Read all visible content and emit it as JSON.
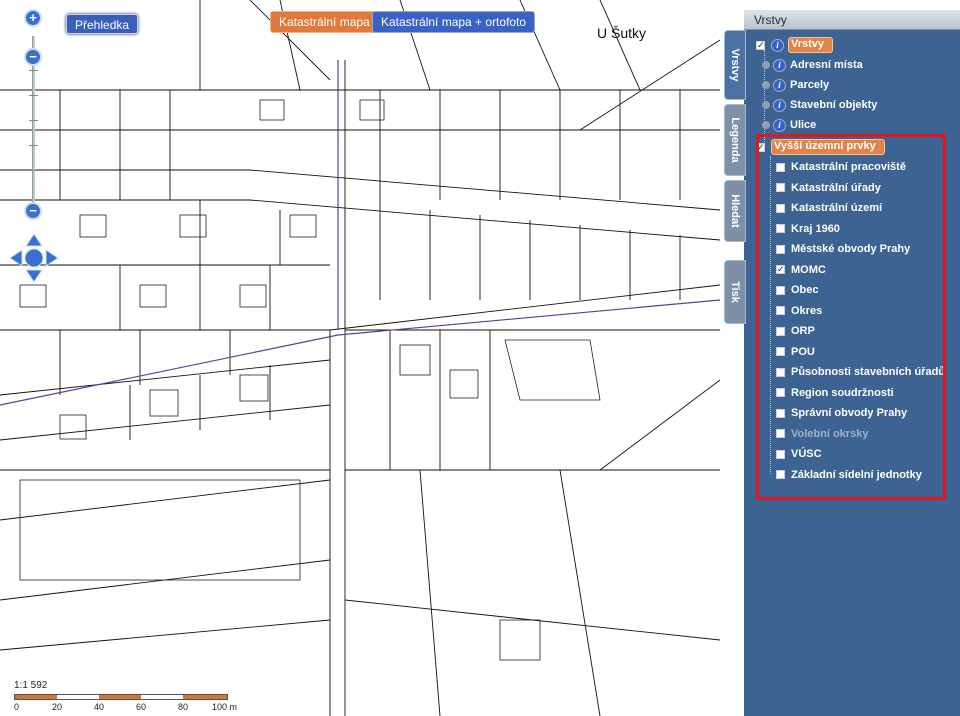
{
  "toolbar": {
    "overview_label": "Přehledka",
    "cadastral_label": "Katastrální mapa",
    "cadastral_ortho_label": "Katastrální mapa + ortofoto"
  },
  "zoom": {
    "in": "+",
    "out": "−"
  },
  "map": {
    "street_label": "U Šutky",
    "scale_text": "1:1 592",
    "scale_ticks": [
      "0",
      "20",
      "40",
      "60",
      "80",
      "100 m"
    ],
    "colors": {
      "road_line": "#5a3fa0",
      "accent": "#e07a3c"
    }
  },
  "panel": {
    "title": "Vrstvy",
    "tabs": [
      "Vrstvy",
      "Legenda",
      "Hledat",
      "Tisk"
    ],
    "root": {
      "label": "Vrstvy",
      "checked": true
    },
    "layers": [
      "Adresní místa",
      "Parcely",
      "Stavební objekty",
      "Ulice"
    ],
    "group": {
      "label": "Vyšší územní prvky",
      "checked": true
    },
    "group_items": [
      {
        "label": "Katastrální pracoviště",
        "checked": false,
        "disabled": false
      },
      {
        "label": "Katastrální úřady",
        "checked": false,
        "disabled": false
      },
      {
        "label": "Katastrální území",
        "checked": false,
        "disabled": false
      },
      {
        "label": "Kraj 1960",
        "checked": false,
        "disabled": false
      },
      {
        "label": "Městské obvody Prahy",
        "checked": false,
        "disabled": false
      },
      {
        "label": "MOMC",
        "checked": true,
        "disabled": false
      },
      {
        "label": "Obec",
        "checked": false,
        "disabled": false
      },
      {
        "label": "Okres",
        "checked": false,
        "disabled": false
      },
      {
        "label": "ORP",
        "checked": false,
        "disabled": false
      },
      {
        "label": "POU",
        "checked": false,
        "disabled": false
      },
      {
        "label": "Působnosti stavebních úřadů",
        "checked": false,
        "disabled": false
      },
      {
        "label": "Region soudržnosti",
        "checked": false,
        "disabled": false
      },
      {
        "label": "Správní obvody Prahy",
        "checked": false,
        "disabled": false
      },
      {
        "label": "Volební okrsky",
        "checked": false,
        "disabled": true
      },
      {
        "label": "VÚSC",
        "checked": false,
        "disabled": false
      },
      {
        "label": "Základní sídelní jednotky",
        "checked": false,
        "disabled": false
      }
    ],
    "highlight_color": "#e3161d"
  }
}
